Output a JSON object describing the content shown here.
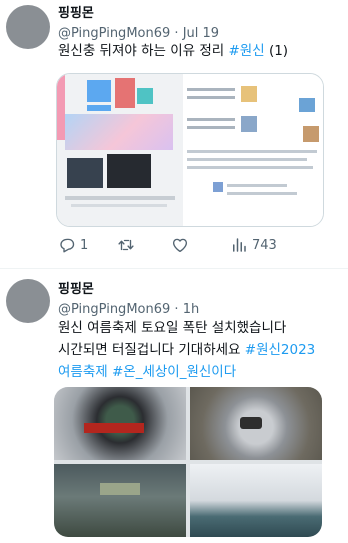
{
  "tweets": [
    {
      "display_name": "핑핑몬",
      "handle": "@PingPingMon69",
      "separator": "·",
      "time": "Jul 19",
      "text_plain": "원신충 뒤져야 하는 이유 정리 ",
      "hashtag": "#원신",
      "text_suffix": " (1)",
      "actions": {
        "replies": "1",
        "retweets": "",
        "likes": "",
        "views": "743"
      }
    },
    {
      "display_name": "핑핑몬",
      "handle": "@PingPingMon69",
      "separator": "·",
      "time": "1h",
      "line1": "원신 여름축제 토요일 폭탄 설치했습니다",
      "line2_plain": "시간되면 터질겁니다 기대하세요 ",
      "line2_hashtag": "#원신2023",
      "line3_hashtags": "여름축제 #온_세상이_원신이다"
    }
  ],
  "icons": {
    "reply": "reply-icon",
    "retweet": "retweet-icon",
    "like": "heart-icon",
    "views": "views-icon"
  },
  "colors": {
    "hashtag": "#1d9bf0",
    "secondary_text": "#536471",
    "avatar": "#8a8f94"
  }
}
